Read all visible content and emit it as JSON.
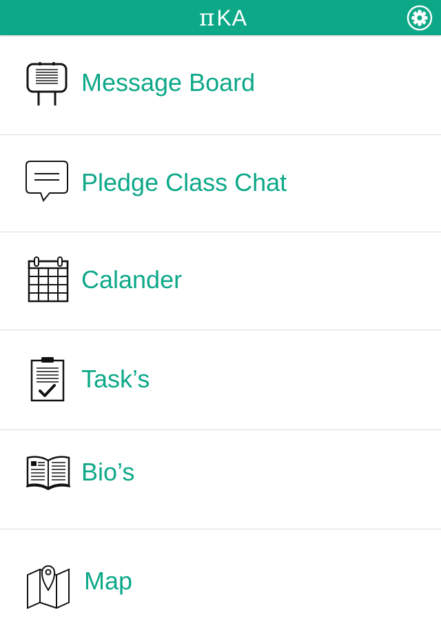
{
  "header": {
    "title_symbol": "π",
    "title_text": "KA",
    "settings_icon": "gear-icon",
    "accent_color": "#0ca888"
  },
  "menu": {
    "items": [
      {
        "label": "Message Board",
        "icon": "message-board-icon"
      },
      {
        "label": "Pledge Class Chat",
        "icon": "chat-bubble-icon"
      },
      {
        "label": "Calander",
        "icon": "calendar-icon"
      },
      {
        "label": "Task’s",
        "icon": "clipboard-check-icon"
      },
      {
        "label": "Bio’s",
        "icon": "open-book-icon"
      },
      {
        "label": "Map",
        "icon": "map-pin-icon"
      }
    ]
  }
}
